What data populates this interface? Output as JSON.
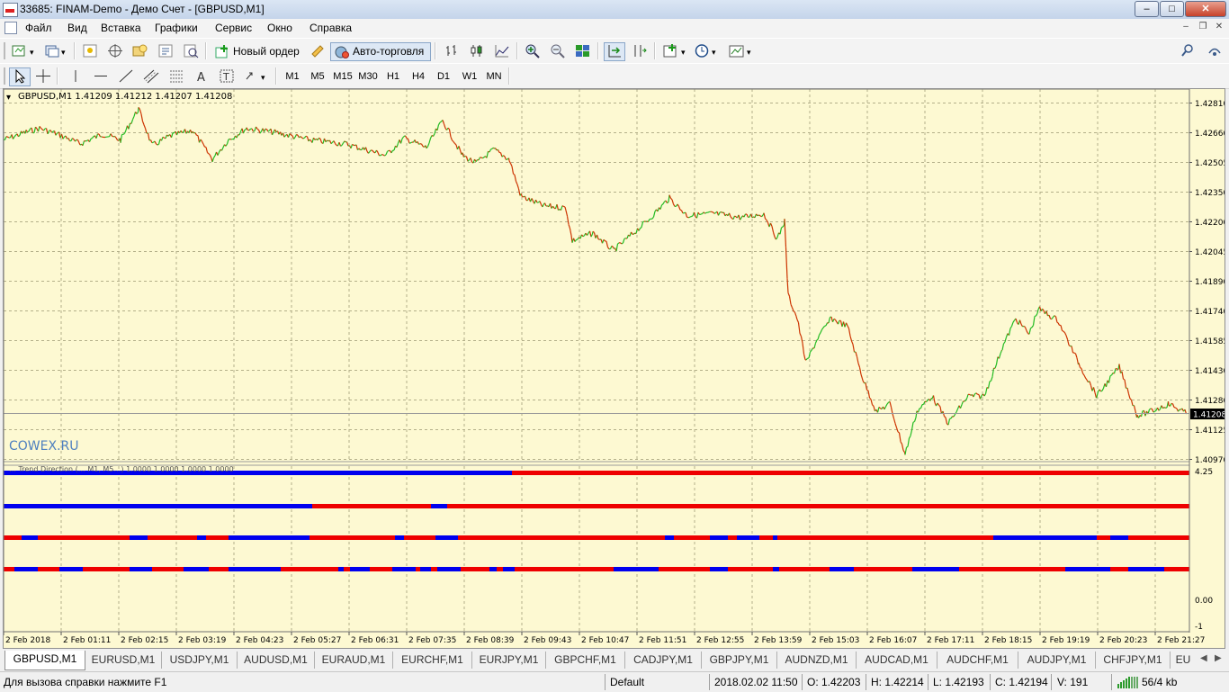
{
  "window": {
    "title": "33685: FINAM-Demo - Демо Счет - [GBPUSD,M1]"
  },
  "menu": [
    "Файл",
    "Вид",
    "Вставка",
    "Графики",
    "Сервис",
    "Окно",
    "Справка"
  ],
  "toolbar": {
    "new_order": "Новый ордер",
    "autotrade": "Авто-торговля"
  },
  "timeframes": [
    "M1",
    "M5",
    "M15",
    "M30",
    "H1",
    "H4",
    "D1",
    "W1",
    "MN"
  ],
  "chart": {
    "header": "GBPUSD,M1  1.41209 1.41212 1.41207 1.41208",
    "price_ticks": [
      "1.42810",
      "1.42660",
      "1.42505",
      "1.42350",
      "1.42200",
      "1.42045",
      "1.41890",
      "1.41740",
      "1.41585",
      "1.41430",
      "1.41280",
      "1.41125",
      "1.40970"
    ],
    "current_price": "1.41208",
    "watermark": "COWEX.RU",
    "indicator_ticks": [
      "4.25",
      "0.00",
      "-1"
    ],
    "indicator_header": "… Trend Direction (… M1, M5…) 1.0000 1.0000 1.0000 1.0000",
    "time_ticks": [
      "2 Feb 2018",
      "2 Feb 01:11",
      "2 Feb 02:15",
      "2 Feb 03:19",
      "2 Feb 04:23",
      "2 Feb 05:27",
      "2 Feb 06:31",
      "2 Feb 07:35",
      "2 Feb 08:39",
      "2 Feb 09:43",
      "2 Feb 10:47",
      "2 Feb 11:51",
      "2 Feb 12:55",
      "2 Feb 13:59",
      "2 Feb 15:03",
      "2 Feb 16:07",
      "2 Feb 17:11",
      "2 Feb 18:15",
      "2 Feb 19:19",
      "2 Feb 20:23",
      "2 Feb 21:27"
    ],
    "colors": {
      "background": "#fdf9d2",
      "grid": "#b4b08a",
      "bull": "#22bb22",
      "bear": "#cc3300",
      "ind_up": "#0000ee",
      "ind_down": "#ee0000"
    },
    "price_series": [
      [
        0,
        1.4262
      ],
      [
        25,
        1.4266
      ],
      [
        40,
        1.4268
      ],
      [
        60,
        1.4265
      ],
      [
        85,
        1.426
      ],
      [
        110,
        1.4265
      ],
      [
        130,
        1.4262
      ],
      [
        150,
        1.4278
      ],
      [
        165,
        1.4259
      ],
      [
        185,
        1.4264
      ],
      [
        210,
        1.4267
      ],
      [
        232,
        1.4252
      ],
      [
        250,
        1.4262
      ],
      [
        270,
        1.4268
      ],
      [
        300,
        1.4266
      ],
      [
        340,
        1.4262
      ],
      [
        380,
        1.426
      ],
      [
        425,
        1.4254
      ],
      [
        445,
        1.4263
      ],
      [
        470,
        1.4258
      ],
      [
        488,
        1.4272
      ],
      [
        510,
        1.4254
      ],
      [
        525,
        1.425
      ],
      [
        545,
        1.4257
      ],
      [
        562,
        1.4252
      ],
      [
        575,
        1.4233
      ],
      [
        600,
        1.4228
      ],
      [
        625,
        1.4227
      ],
      [
        632,
        1.421
      ],
      [
        655,
        1.4214
      ],
      [
        678,
        1.4205
      ],
      [
        700,
        1.4214
      ],
      [
        715,
        1.422
      ],
      [
        740,
        1.4232
      ],
      [
        760,
        1.4223
      ],
      [
        790,
        1.4224
      ],
      [
        820,
        1.4222
      ],
      [
        845,
        1.4224
      ],
      [
        860,
        1.4211
      ],
      [
        868,
        1.422
      ],
      [
        872,
        1.4182
      ],
      [
        882,
        1.417
      ],
      [
        892,
        1.4147
      ],
      [
        905,
        1.416
      ],
      [
        920,
        1.417
      ],
      [
        938,
        1.4166
      ],
      [
        955,
        1.4139
      ],
      [
        970,
        1.4122
      ],
      [
        985,
        1.4126
      ],
      [
        1002,
        1.41
      ],
      [
        1015,
        1.4122
      ],
      [
        1032,
        1.413
      ],
      [
        1050,
        1.4116
      ],
      [
        1072,
        1.413
      ],
      [
        1090,
        1.413
      ],
      [
        1110,
        1.4155
      ],
      [
        1125,
        1.417
      ],
      [
        1140,
        1.4162
      ],
      [
        1150,
        1.4175
      ],
      [
        1172,
        1.4169
      ],
      [
        1195,
        1.4147
      ],
      [
        1215,
        1.413
      ],
      [
        1240,
        1.4145
      ],
      [
        1260,
        1.412
      ],
      [
        1275,
        1.4122
      ],
      [
        1295,
        1.4126
      ],
      [
        1315,
        1.4121
      ]
    ],
    "indicator_rows": [
      [
        [
          "up",
          0,
          565
        ],
        [
          "down",
          565,
          1318
        ]
      ],
      [
        [
          "up",
          0,
          343
        ],
        [
          "down",
          343,
          475
        ],
        [
          "up",
          475,
          493
        ],
        [
          "down",
          493,
          1318
        ]
      ],
      [
        [
          "down",
          0,
          20
        ],
        [
          "up",
          20,
          38
        ],
        [
          "down",
          38,
          140
        ],
        [
          "up",
          140,
          160
        ],
        [
          "down",
          160,
          215
        ],
        [
          "up",
          215,
          225
        ],
        [
          "down",
          225,
          250
        ],
        [
          "up",
          250,
          340
        ],
        [
          "down",
          340,
          435
        ],
        [
          "up",
          435,
          445
        ],
        [
          "down",
          445,
          480
        ],
        [
          "up",
          480,
          505
        ],
        [
          "down",
          505,
          735
        ],
        [
          "up",
          735,
          745
        ],
        [
          "down",
          745,
          785
        ],
        [
          "up",
          785,
          805
        ],
        [
          "down",
          805,
          815
        ],
        [
          "up",
          815,
          840
        ],
        [
          "down",
          840,
          855
        ],
        [
          "up",
          855,
          860
        ],
        [
          "down",
          860,
          1100
        ],
        [
          "up",
          1100,
          1215
        ],
        [
          "down",
          1215,
          1230
        ],
        [
          "up",
          1230,
          1250
        ],
        [
          "down",
          1250,
          1318
        ]
      ],
      [
        [
          "down",
          0,
          12
        ],
        [
          "up",
          12,
          38
        ],
        [
          "down",
          38,
          62
        ],
        [
          "up",
          62,
          88
        ],
        [
          "down",
          88,
          140
        ],
        [
          "up",
          140,
          165
        ],
        [
          "down",
          165,
          200
        ],
        [
          "up",
          200,
          228
        ],
        [
          "down",
          228,
          250
        ],
        [
          "up",
          250,
          308
        ],
        [
          "down",
          308,
          372
        ],
        [
          "up",
          372,
          378
        ],
        [
          "down",
          378,
          385
        ],
        [
          "up",
          385,
          407
        ],
        [
          "down",
          407,
          432
        ],
        [
          "up",
          432,
          458
        ],
        [
          "down",
          458,
          463
        ],
        [
          "up",
          463,
          475
        ],
        [
          "down",
          475,
          482
        ],
        [
          "up",
          482,
          508
        ],
        [
          "down",
          508,
          540
        ],
        [
          "up",
          540,
          548
        ],
        [
          "down",
          548,
          555
        ],
        [
          "up",
          555,
          568
        ],
        [
          "down",
          568,
          678
        ],
        [
          "up",
          678,
          728
        ],
        [
          "down",
          728,
          785
        ],
        [
          "up",
          785,
          805
        ],
        [
          "down",
          805,
          855
        ],
        [
          "up",
          855,
          862
        ],
        [
          "down",
          862,
          918
        ],
        [
          "up",
          918,
          945
        ],
        [
          "down",
          945,
          1010
        ],
        [
          "up",
          1010,
          1062
        ],
        [
          "down",
          1062,
          1180
        ],
        [
          "up",
          1180,
          1230
        ],
        [
          "down",
          1230,
          1250
        ],
        [
          "up",
          1250,
          1290
        ],
        [
          "down",
          1290,
          1318
        ]
      ]
    ]
  },
  "tabs": [
    "GBPUSD,M1",
    "EURUSD,M1",
    "USDJPY,M1",
    "AUDUSD,M1",
    "EURAUD,M1",
    "EURCHF,M1",
    "EURJPY,M1",
    "GBPCHF,M1",
    "CADJPY,M1",
    "GBPJPY,M1",
    "AUDNZD,M1",
    "AUDCAD,M1",
    "AUDCHF,M1",
    "AUDJPY,M1",
    "CHFJPY,M1",
    "EU"
  ],
  "status": {
    "help": "Для вызова справки нажмите F1",
    "profile": "Default",
    "datetime": "2018.02.02 11:50",
    "open": "O: 1.42203",
    "high": "H: 1.42214",
    "low": "L: 1.42193",
    "close": "C: 1.42194",
    "volume": "V: 191",
    "traffic": "56/4 kb"
  }
}
